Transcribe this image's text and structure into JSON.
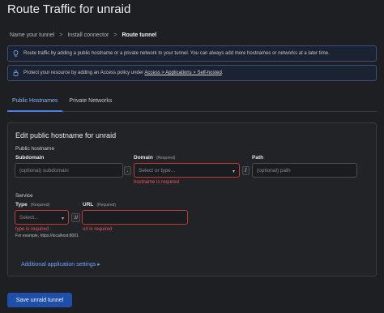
{
  "page_title": "Route Traffic for unraid",
  "breadcrumb": {
    "step1": "Name your tunnel",
    "step2": "Install connector",
    "step3": "Route tunnel",
    "separator": ">"
  },
  "banners": {
    "info_text": "Route traffic by adding a public hostname or a private network to your tunnel. You can always add more hostnames or networks at a later time.",
    "info_icon": "lightbulb-icon",
    "access_prefix": "Protect your resource by adding an Access policy under ",
    "access_link": "Access > Applications > Self-hosted",
    "access_suffix": ".",
    "access_icon": "lock-icon",
    "accent_color": "#3b4f7a"
  },
  "tabs": [
    {
      "label": "Public Hostnames",
      "active": true
    },
    {
      "label": "Private Networks",
      "active": false
    }
  ],
  "form": {
    "title": "Edit public hostname for unraid",
    "public_hostname_label": "Public hostname",
    "subdomain": {
      "label": "Subdomain",
      "placeholder": "(optional) subdomain"
    },
    "subdomain_dot": ".",
    "domain": {
      "label": "Domain",
      "required": "(Required)",
      "value": "Select or type...",
      "error": "hostname is required"
    },
    "path_separator": "/",
    "path": {
      "label": "Path",
      "placeholder": "(optional) path"
    },
    "service_label": "Service",
    "type": {
      "label": "Type",
      "required": "(Required)",
      "value": "Select...",
      "error": "type is required",
      "hint": "For example, https://localhost:8001"
    },
    "scheme_separator": "://",
    "url": {
      "label": "URL",
      "required": "(Required)",
      "value": "",
      "error": "url is required"
    },
    "additional_settings": "Additional application settings",
    "additional_chevron": "chevron-right-icon"
  },
  "save_button": "Save unraid tunnel",
  "colors": {
    "background": "#1e1f22",
    "primary": "#1f4fa8",
    "error": "#c0393b",
    "link": "#6fa3ff"
  }
}
